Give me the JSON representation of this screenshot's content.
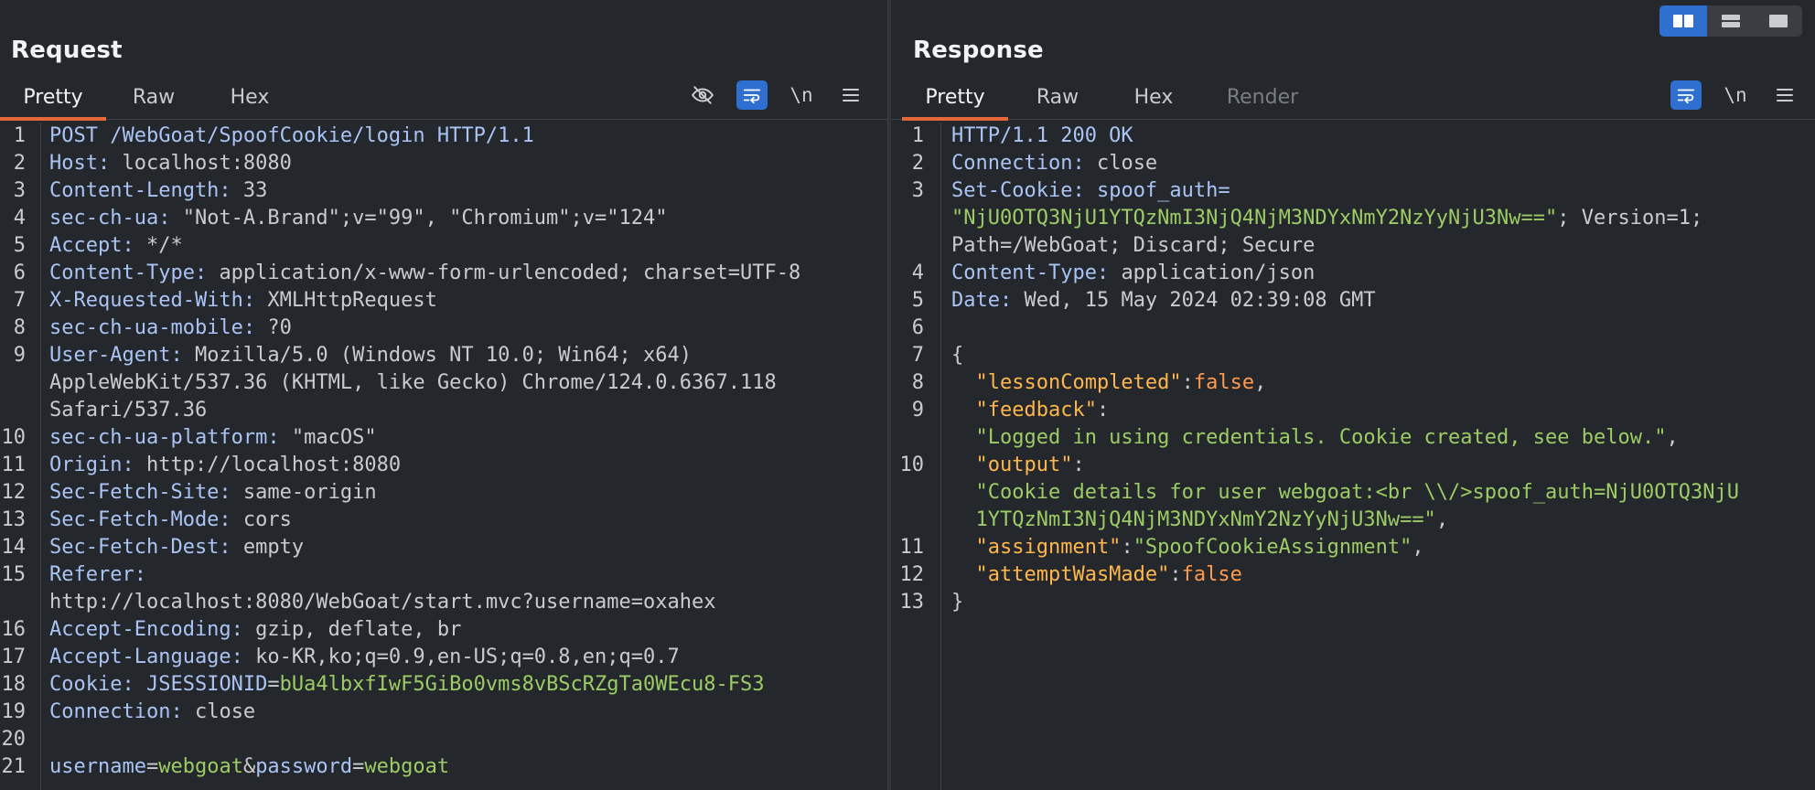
{
  "request": {
    "title": "Request",
    "tabs": [
      "Pretty",
      "Raw",
      "Hex"
    ],
    "active_tab": "Pretty",
    "tools": {
      "hide_icon": "eye-slash-icon",
      "wrap_icon": "wrap-lines-icon",
      "newline_label": "\\n",
      "menu_icon": "hamburger-menu-icon"
    },
    "lines": [
      {
        "num": "1",
        "parts": [
          {
            "t": "POST /WebGoat/SpoofCookie/login HTTP/1.1",
            "c": "k"
          }
        ]
      },
      {
        "num": "2",
        "parts": [
          {
            "t": "Host: ",
            "c": "k"
          },
          {
            "t": "localhost:8080",
            "c": "v"
          }
        ]
      },
      {
        "num": "3",
        "parts": [
          {
            "t": "Content-Length: ",
            "c": "k"
          },
          {
            "t": "33",
            "c": "v"
          }
        ]
      },
      {
        "num": "4",
        "parts": [
          {
            "t": "sec-ch-ua: ",
            "c": "k"
          },
          {
            "t": "\"Not-A.Brand\";v=\"99\", \"Chromium\";v=\"124\"",
            "c": "v"
          }
        ]
      },
      {
        "num": "5",
        "parts": [
          {
            "t": "Accept: ",
            "c": "k"
          },
          {
            "t": "*/*",
            "c": "v"
          }
        ]
      },
      {
        "num": "6",
        "parts": [
          {
            "t": "Content-Type: ",
            "c": "k"
          },
          {
            "t": "application/x-www-form-urlencoded; charset=UTF-8",
            "c": "v"
          }
        ]
      },
      {
        "num": "7",
        "parts": [
          {
            "t": "X-Requested-With: ",
            "c": "k"
          },
          {
            "t": "XMLHttpRequest",
            "c": "v"
          }
        ]
      },
      {
        "num": "8",
        "parts": [
          {
            "t": "sec-ch-ua-mobile: ",
            "c": "k"
          },
          {
            "t": "?0",
            "c": "v"
          }
        ]
      },
      {
        "num": "9",
        "parts": [
          {
            "t": "User-Agent: ",
            "c": "k"
          },
          {
            "t": "Mozilla/5.0 (Windows NT 10.0; Win64; x64)",
            "c": "v"
          }
        ]
      },
      {
        "num": "",
        "parts": [
          {
            "t": "AppleWebKit/537.36 (KHTML, like Gecko) Chrome/124.0.6367.118",
            "c": "v"
          }
        ]
      },
      {
        "num": "",
        "parts": [
          {
            "t": "Safari/537.36",
            "c": "v"
          }
        ]
      },
      {
        "num": "10",
        "parts": [
          {
            "t": "sec-ch-ua-platform: ",
            "c": "k"
          },
          {
            "t": "\"macOS\"",
            "c": "v"
          }
        ]
      },
      {
        "num": "11",
        "parts": [
          {
            "t": "Origin: ",
            "c": "k"
          },
          {
            "t": "http://localhost:8080",
            "c": "v"
          }
        ]
      },
      {
        "num": "12",
        "parts": [
          {
            "t": "Sec-Fetch-Site: ",
            "c": "k"
          },
          {
            "t": "same-origin",
            "c": "v"
          }
        ]
      },
      {
        "num": "13",
        "parts": [
          {
            "t": "Sec-Fetch-Mode: ",
            "c": "k"
          },
          {
            "t": "cors",
            "c": "v"
          }
        ]
      },
      {
        "num": "14",
        "parts": [
          {
            "t": "Sec-Fetch-Dest: ",
            "c": "k"
          },
          {
            "t": "empty",
            "c": "v"
          }
        ]
      },
      {
        "num": "15",
        "parts": [
          {
            "t": "Referer: ",
            "c": "k"
          }
        ]
      },
      {
        "num": "",
        "parts": [
          {
            "t": "http://localhost:8080/WebGoat/start.mvc?username=oxahex",
            "c": "v"
          }
        ]
      },
      {
        "num": "16",
        "parts": [
          {
            "t": "Accept-Encoding: ",
            "c": "k"
          },
          {
            "t": "gzip, deflate, br",
            "c": "v"
          }
        ]
      },
      {
        "num": "17",
        "parts": [
          {
            "t": "Accept-Language: ",
            "c": "k"
          },
          {
            "t": "ko-KR,ko;q=0.9,en-US;q=0.8,en;q=0.7",
            "c": "v"
          }
        ]
      },
      {
        "num": "18",
        "parts": [
          {
            "t": "Cookie: ",
            "c": "k"
          },
          {
            "t": "JSESSIONID",
            "c": "k"
          },
          {
            "t": "=",
            "c": "v"
          },
          {
            "t": "bUa4lbxfIwF5GiBo0vms8vBScRZgTa0WEcu8-FS3",
            "c": "s"
          }
        ]
      },
      {
        "num": "19",
        "parts": [
          {
            "t": "Connection: ",
            "c": "k"
          },
          {
            "t": "close",
            "c": "v"
          }
        ]
      },
      {
        "num": "20",
        "parts": []
      },
      {
        "num": "21",
        "parts": [
          {
            "t": "username",
            "c": "k"
          },
          {
            "t": "=",
            "c": "v"
          },
          {
            "t": "webgoat",
            "c": "s"
          },
          {
            "t": "&",
            "c": "v"
          },
          {
            "t": "password",
            "c": "k"
          },
          {
            "t": "=",
            "c": "v"
          },
          {
            "t": "webgoat",
            "c": "s"
          }
        ]
      }
    ]
  },
  "response": {
    "title": "Response",
    "tabs": [
      "Pretty",
      "Raw",
      "Hex",
      "Render"
    ],
    "active_tab": "Pretty",
    "tools": {
      "wrap_icon": "wrap-lines-icon",
      "newline_label": "\\n",
      "menu_icon": "hamburger-menu-icon"
    },
    "lines": [
      {
        "num": "1",
        "parts": [
          {
            "t": "HTTP/1.1 200 OK",
            "c": "k"
          }
        ]
      },
      {
        "num": "2",
        "parts": [
          {
            "t": "Connection: ",
            "c": "k"
          },
          {
            "t": "close",
            "c": "v"
          }
        ]
      },
      {
        "num": "3",
        "parts": [
          {
            "t": "Set-Cookie: ",
            "c": "k"
          },
          {
            "t": "spoof_auth=",
            "c": "k"
          }
        ]
      },
      {
        "num": "",
        "parts": [
          {
            "t": "\"NjU0OTQ3NjU1YTQzNmI3NjQ4NjM3NDYxNmY2NzYyNjU3Nw==\"",
            "c": "s"
          },
          {
            "t": "; Version=1;",
            "c": "v"
          }
        ]
      },
      {
        "num": "",
        "parts": [
          {
            "t": "Path=/WebGoat; Discard; Secure",
            "c": "v"
          }
        ]
      },
      {
        "num": "4",
        "parts": [
          {
            "t": "Content-Type: ",
            "c": "k"
          },
          {
            "t": "application/json",
            "c": "v"
          }
        ]
      },
      {
        "num": "5",
        "parts": [
          {
            "t": "Date: ",
            "c": "k"
          },
          {
            "t": "Wed, 15 May 2024 02:39:08 GMT",
            "c": "v"
          }
        ]
      },
      {
        "num": "6",
        "parts": []
      },
      {
        "num": "7",
        "parts": [
          {
            "t": "{",
            "c": "v"
          }
        ]
      },
      {
        "num": "8",
        "parts": [
          {
            "t": "  \"lessonCompleted\"",
            "c": "jk"
          },
          {
            "t": ":",
            "c": "v"
          },
          {
            "t": "false",
            "c": "b"
          },
          {
            "t": ",",
            "c": "v"
          }
        ]
      },
      {
        "num": "9",
        "parts": [
          {
            "t": "  \"feedback\"",
            "c": "jk"
          },
          {
            "t": ":",
            "c": "v"
          }
        ]
      },
      {
        "num": "",
        "parts": [
          {
            "t": "  \"Logged in using credentials. Cookie created, see below.\"",
            "c": "s"
          },
          {
            "t": ",",
            "c": "v"
          }
        ]
      },
      {
        "num": "10",
        "parts": [
          {
            "t": "  \"output\"",
            "c": "jk"
          },
          {
            "t": ":",
            "c": "v"
          }
        ]
      },
      {
        "num": "",
        "parts": [
          {
            "t": "  \"Cookie details for user webgoat:<br \\\\/>spoof_auth=NjU0OTQ3NjU",
            "c": "s"
          }
        ]
      },
      {
        "num": "",
        "parts": [
          {
            "t": "  1YTQzNmI3NjQ4NjM3NDYxNmY2NzYyNjU3Nw==\"",
            "c": "s"
          },
          {
            "t": ",",
            "c": "v"
          }
        ]
      },
      {
        "num": "11",
        "parts": [
          {
            "t": "  \"assignment\"",
            "c": "jk"
          },
          {
            "t": ":",
            "c": "v"
          },
          {
            "t": "\"SpoofCookieAssignment\"",
            "c": "s"
          },
          {
            "t": ",",
            "c": "v"
          }
        ]
      },
      {
        "num": "12",
        "parts": [
          {
            "t": "  \"attemptWasMade\"",
            "c": "jk"
          },
          {
            "t": ":",
            "c": "v"
          },
          {
            "t": "false",
            "c": "b"
          }
        ]
      },
      {
        "num": "13",
        "parts": [
          {
            "t": "}",
            "c": "v"
          }
        ]
      }
    ]
  },
  "layout_buttons": [
    "split-horizontal-icon",
    "split-vertical-icon",
    "single-pane-icon"
  ],
  "colors": {
    "accent": "#2e6fd0",
    "active_tab_underline": "#e5673a",
    "header_key": "#a9c4f5",
    "string": "#9ccc65",
    "boolean": "#ff9a4d",
    "json_key": "#ffb74d"
  }
}
